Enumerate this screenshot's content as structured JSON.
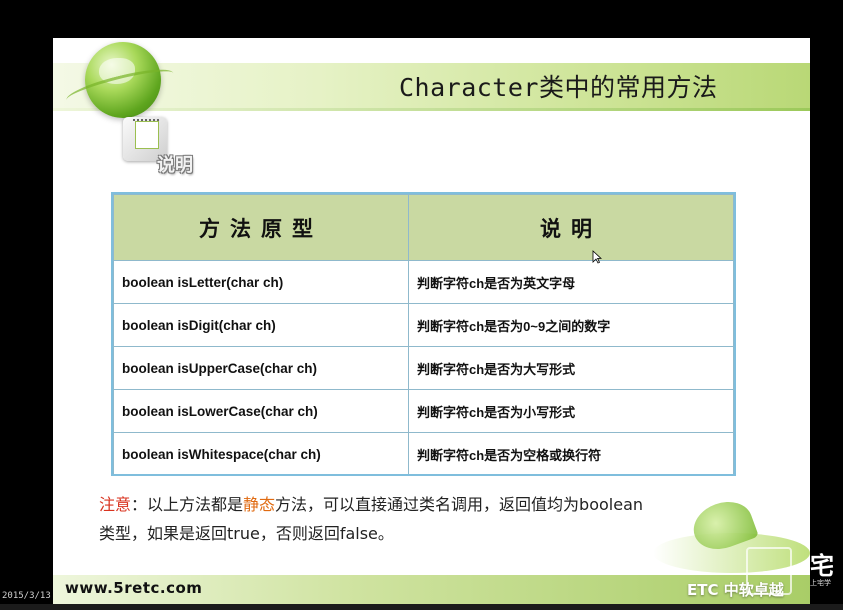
{
  "slide": {
    "title": "Character类中的常用方法",
    "note_label": "说明",
    "table": {
      "headers": [
        "方法原型",
        "说明"
      ],
      "rows": [
        {
          "signature": "boolean isLetter(char ch)",
          "desc": "判断字符ch是否为英文字母"
        },
        {
          "signature": "boolean isDigit(char ch)",
          "desc": "判断字符ch是否为0~9之间的数字"
        },
        {
          "signature": "boolean isUpperCase(char ch)",
          "desc": "判断字符ch是否为大写形式"
        },
        {
          "signature": "boolean isLowerCase(char ch)",
          "desc": "判断字符ch是否为小写形式"
        },
        {
          "signature": "boolean isWhitespace(char ch)",
          "desc": "判断字符ch是否为空格或换行符"
        }
      ]
    },
    "note": {
      "prefix": "注意",
      "text1": "：以上方法都是",
      "highlight": "静态",
      "text2": "方法，可以直接通过类名调用，返回值均为boolean类型，如果是返回true，否则返回false。"
    },
    "footer_site": "www.5retc.com",
    "footer_logo": "ETC 中软卓越"
  },
  "overlay": {
    "date": "2015/3/13",
    "watermark_text": "宅",
    "watermark_sub": "上宅学"
  },
  "colors": {
    "header_green": "#b9d876",
    "table_header": "#c9d9a2",
    "table_border": "#8fb9cc",
    "note_red": "#d9331f",
    "note_orange": "#e06a10"
  },
  "icons": [
    "globe-icon",
    "notebook-icon",
    "mouse-cursor-icon",
    "plant-icon"
  ]
}
